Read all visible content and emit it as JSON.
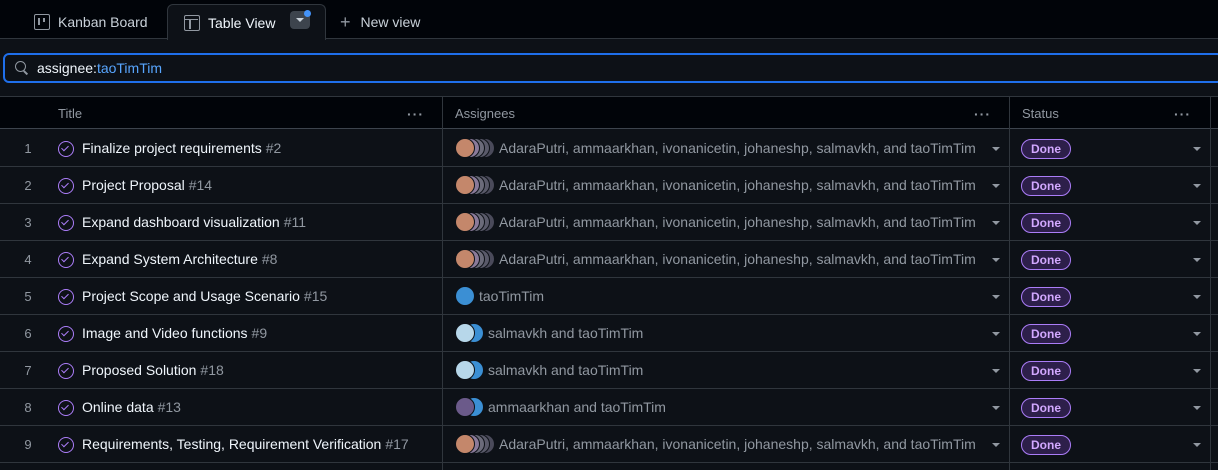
{
  "tabs": [
    {
      "label": "Kanban Board",
      "icon": "board-icon"
    },
    {
      "label": "Table View",
      "icon": "table-icon",
      "active": true
    },
    {
      "label": "New view",
      "icon": "plus-icon"
    }
  ],
  "filter": {
    "key": "assignee:",
    "value": "taoTimTim"
  },
  "columns": {
    "title": "Title",
    "assignees": "Assignees",
    "status": "Status"
  },
  "colors": {
    "accent": "#1f6feb",
    "done": "#ab7df8",
    "link": "#58a6ff"
  },
  "rows": [
    {
      "num": "1",
      "title": "Finalize project requirements",
      "issue": "#2",
      "assignees": "AdaraPutri, ammaarkhan, ivonanicetin, johaneshp, salmavkh, and taoTimTim",
      "status": "Done"
    },
    {
      "num": "2",
      "title": "Project Proposal",
      "issue": "#14",
      "assignees": "AdaraPutri, ammaarkhan, ivonanicetin, johaneshp, salmavkh, and taoTimTim",
      "status": "Done"
    },
    {
      "num": "3",
      "title": "Expand dashboard visualization",
      "issue": "#11",
      "assignees": "AdaraPutri, ammaarkhan, ivonanicetin, johaneshp, salmavkh, and taoTimTim",
      "status": "Done"
    },
    {
      "num": "4",
      "title": "Expand System Architecture",
      "issue": "#8",
      "assignees": "AdaraPutri, ammaarkhan, ivonanicetin, johaneshp, salmavkh, and taoTimTim",
      "status": "Done"
    },
    {
      "num": "5",
      "title": "Project Scope and Usage Scenario",
      "issue": "#15",
      "assignees": "taoTimTim",
      "status": "Done"
    },
    {
      "num": "6",
      "title": "Image and Video functions",
      "issue": "#9",
      "assignees": "salmavkh and taoTimTim",
      "status": "Done"
    },
    {
      "num": "7",
      "title": "Proposed Solution",
      "issue": "#18",
      "assignees": "salmavkh and taoTimTim",
      "status": "Done"
    },
    {
      "num": "8",
      "title": "Online data",
      "issue": "#13",
      "assignees": "ammaarkhan and taoTimTim",
      "status": "Done"
    },
    {
      "num": "9",
      "title": "Requirements, Testing, Requirement Verification",
      "issue": "#17",
      "assignees": "AdaraPutri, ammaarkhan, ivonanicetin, johaneshp, salmavkh, and taoTimTim",
      "status": "Done"
    }
  ]
}
